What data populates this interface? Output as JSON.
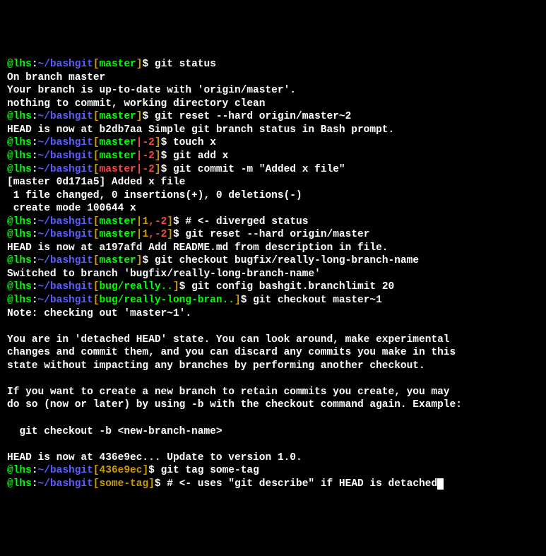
{
  "lines": [
    {
      "type": "prompt",
      "user": "@lhs",
      "host": "~/bashgit",
      "branch": "master",
      "branch_color": "green",
      "cmd": "git status"
    },
    {
      "type": "output",
      "text": "On branch master"
    },
    {
      "type": "output",
      "text": "Your branch is up-to-date with 'origin/master'."
    },
    {
      "type": "output",
      "text": "nothing to commit, working directory clean"
    },
    {
      "type": "prompt",
      "user": "@lhs",
      "host": "~/bashgit",
      "branch": "master",
      "branch_color": "green",
      "cmd": "git reset --hard origin/master~2"
    },
    {
      "type": "output",
      "text": "HEAD is now at b2db7aa Simple git branch status in Bash prompt."
    },
    {
      "type": "prompt",
      "user": "@lhs",
      "host": "~/bashgit",
      "branch": "master",
      "branch_color": "green",
      "suffix": "|-2",
      "suffix_color": "red",
      "cmd": "touch x"
    },
    {
      "type": "prompt",
      "user": "@lhs",
      "host": "~/bashgit",
      "branch": "master",
      "branch_color": "green",
      "suffix": "|-2",
      "suffix_color": "red",
      "cmd": "git add x"
    },
    {
      "type": "prompt",
      "user": "@lhs",
      "host": "~/bashgit",
      "branch": "master",
      "branch_color": "red",
      "suffix": "|-2",
      "suffix_color": "red",
      "cmd": "git commit -m \"Added x file\""
    },
    {
      "type": "output",
      "text": "[master 0d171a5] Added x file"
    },
    {
      "type": "output",
      "text": " 1 file changed, 0 insertions(+), 0 deletions(-)"
    },
    {
      "type": "output",
      "text": " create mode 100644 x"
    },
    {
      "type": "prompt",
      "user": "@lhs",
      "host": "~/bashgit",
      "branch": "master",
      "branch_color": "green",
      "presuffix": "|1",
      "presuffix_color": "brown",
      "suffix": ",-2",
      "suffix_color": "red",
      "cmd": "# <- diverged status"
    },
    {
      "type": "prompt",
      "user": "@lhs",
      "host": "~/bashgit",
      "branch": "master",
      "branch_color": "green",
      "presuffix": "|1",
      "presuffix_color": "brown",
      "suffix": ",-2",
      "suffix_color": "red",
      "cmd": "git reset --hard origin/master"
    },
    {
      "type": "output",
      "text": "HEAD is now at a197afd Add README.md from description in file."
    },
    {
      "type": "prompt",
      "user": "@lhs",
      "host": "~/bashgit",
      "branch": "master",
      "branch_color": "green",
      "cmd": "git checkout bugfix/really-long-branch-name"
    },
    {
      "type": "output",
      "text": "Switched to branch 'bugfix/really-long-branch-name'"
    },
    {
      "type": "prompt",
      "user": "@lhs",
      "host": "~/bashgit",
      "branch": "bug/really..",
      "branch_color": "green",
      "cmd": "git config bashgit.branchlimit 20"
    },
    {
      "type": "prompt",
      "user": "@lhs",
      "host": "~/bashgit",
      "branch": "bug/really-long-bran..",
      "branch_color": "green",
      "cmd": "git checkout master~1"
    },
    {
      "type": "output",
      "text": "Note: checking out 'master~1'."
    },
    {
      "type": "output",
      "text": ""
    },
    {
      "type": "output",
      "text": "You are in 'detached HEAD' state. You can look around, make experimental"
    },
    {
      "type": "output",
      "text": "changes and commit them, and you can discard any commits you make in this"
    },
    {
      "type": "output",
      "text": "state without impacting any branches by performing another checkout."
    },
    {
      "type": "output",
      "text": ""
    },
    {
      "type": "output",
      "text": "If you want to create a new branch to retain commits you create, you may"
    },
    {
      "type": "output",
      "text": "do so (now or later) by using -b with the checkout command again. Example:"
    },
    {
      "type": "output",
      "text": ""
    },
    {
      "type": "output",
      "text": "  git checkout -b <new-branch-name>"
    },
    {
      "type": "output",
      "text": ""
    },
    {
      "type": "output",
      "text": "HEAD is now at 436e9ec... Update to version 1.0."
    },
    {
      "type": "prompt",
      "user": "@lhs",
      "host": "~/bashgit",
      "branch": "436e9ec",
      "branch_color": "brown",
      "cmd": "git tag some-tag"
    },
    {
      "type": "prompt",
      "user": "@lhs",
      "host": "~/bashgit",
      "branch": "some-tag",
      "branch_color": "brown",
      "cmd": "# <- uses \"git describe\" if HEAD is detached",
      "cursor": true
    }
  ]
}
